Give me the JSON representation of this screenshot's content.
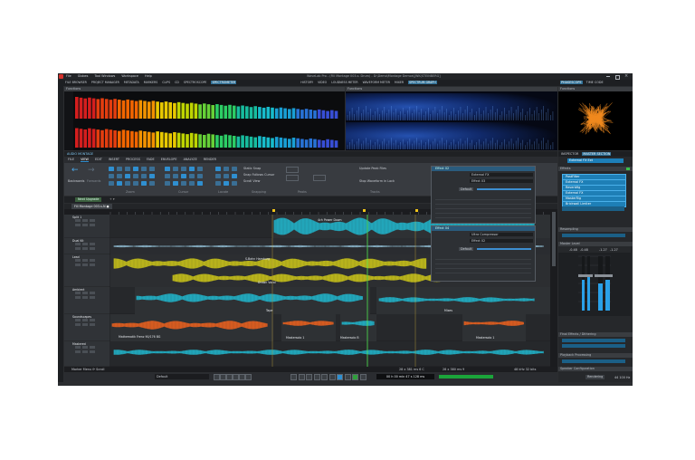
{
  "titlebar": {
    "menu_items": [
      "File",
      "Globes",
      "Tool Windows",
      "Workspace",
      "Help"
    ],
    "window_title": "WaveLab Pro - (Fill Montage 003.s. Drum) - D:\\Demo\\Montage Demos\\[WK(STEINBERG]"
  },
  "toolwindow_tabs": [
    "FILE BROWSER",
    "PROJECT MANAGER",
    "METADATA",
    "MARKERS",
    "CLIPS",
    "CD",
    "SPECTROSCOPE",
    "SPECTROMETER",
    "HISTORY",
    "VIDEO",
    "LOUDNESS METER",
    "WAVEFORM METER",
    "MIXER",
    "SPECTRUM GRAPH"
  ],
  "right_tabs": [
    "PHASESCOPE",
    "TIME CODE"
  ],
  "panel_labels": {
    "functions_left": "Functions",
    "functions_mid": "Functions",
    "functions_right": "Functions"
  },
  "editor": {
    "title": "AUDIO MONTAGE",
    "ribbon_tabs": [
      "FILE",
      "VIEW",
      "EDIT",
      "INSERT",
      "PROCESS",
      "FADE",
      "ENVELOPE",
      "ANALYZE",
      "RENDER"
    ],
    "ribbon_groups": [
      "Zoom",
      "Cursor",
      "Locate",
      "Snapping",
      "Peaks",
      "Tracks"
    ],
    "ribbon_options": [
      "Static Snap",
      "Snap Follows Cursor",
      "Scroll View",
      "Update Peak Files",
      "Stop Waveform in Lock"
    ],
    "nav_labels": [
      "Backwards",
      "Forwards"
    ],
    "montage_tab": "Fill Montage 003.s-N ●",
    "track_group": "Next Upgrade"
  },
  "plugin_windows": [
    {
      "title": "Effect 02",
      "preset": "External FX",
      "preset2": "Effect 03",
      "button": "Default"
    },
    {
      "title": "Effect 04",
      "preset": "Ultra Compressor",
      "preset2": "Effect 02",
      "button": "Default"
    }
  ],
  "tracks": [
    {
      "name": "Split 1",
      "clips": [
        "4ch Power Down"
      ]
    },
    {
      "name": "Dual Kit",
      "clips": []
    },
    {
      "name": "Lead",
      "clips": [
        "S-Bahn Hamburg",
        "Drown Vocal"
      ]
    },
    {
      "name": "Ambient",
      "clips": [
        "Tape",
        "Mixes"
      ]
    },
    {
      "name": "Soundscapes",
      "clips": [
        "Mathematik Frenz 90/176 BG",
        "Mastersolo 1",
        "Mastersolo B",
        "Mastersolo 1"
      ]
    },
    {
      "name": "Mastered",
      "clips": []
    }
  ],
  "inspector": {
    "tabs": [
      "INSPECTOR",
      "MASTER SECTION"
    ],
    "preset_field": "External FX Ext",
    "effects_header": "Effects",
    "effects": [
      "PostFilter",
      "External FX",
      "Reverbfig",
      "External FX",
      "MasterRig",
      "Brickwall Limiter"
    ],
    "resampling": "Resampling",
    "master_level": "Master Level",
    "level_values": [
      "-0.48",
      "-0.48",
      "-1.27",
      "-1.27"
    ],
    "final_effects": "Final Effects / Dithering",
    "playback_processing": "Playback Processing",
    "speaker_configuration": "Speaker Configuration",
    "rendering": "Rendering",
    "sample_rate": "44 100 Hz"
  },
  "statusbar": {
    "left": "Marker Menu  ⟳ Scroll",
    "zoom": "28 x 381 ms 6 C",
    "mid": "28 x 380 ms 9",
    "right": "48 kHz 32 bits",
    "preset": "Default",
    "time_display": "00 h 00 min 47 s 128 ms"
  },
  "colors": {
    "accent": "#2f8fd0",
    "yellow_wave": "#c8c21a",
    "cyan_wave": "#21b3c9",
    "orange_wave": "#e8601f",
    "phasescope": "#f08a1f"
  }
}
